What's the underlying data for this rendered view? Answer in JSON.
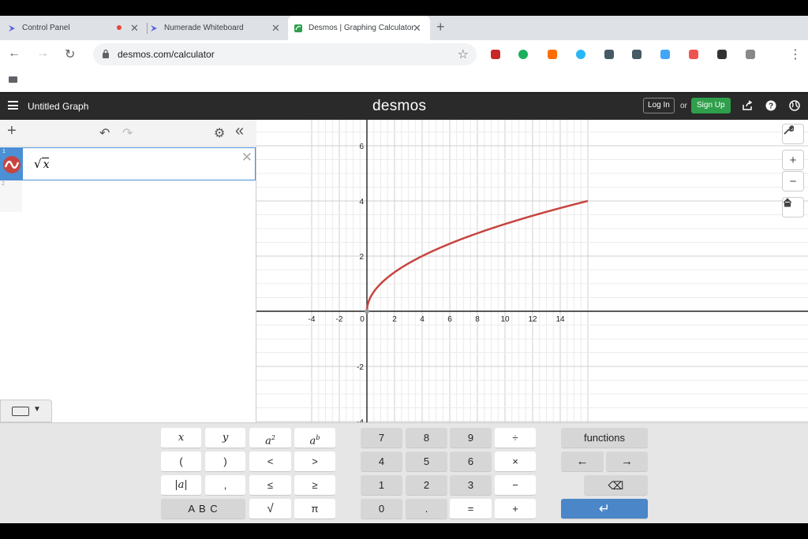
{
  "browser": {
    "tabs": [
      {
        "title": "Control Panel",
        "close": "✕"
      },
      {
        "title": "Numerade Whiteboard",
        "close": "✕"
      },
      {
        "title": "Desmos | Graphing Calculator",
        "close": "✕",
        "active": true
      }
    ],
    "new_tab": "+",
    "back_icon": "←",
    "forward_icon": "→",
    "reload_icon": "↻",
    "url": "desmos.com/calculator",
    "star_icon": "☆",
    "menu_icon": "⋮",
    "extension_colors": [
      "#c62828",
      "#1aaf5d",
      "#ff6d00",
      "#29b6f6",
      "#455a64",
      "#455a64",
      "#42a5f5",
      "#ef5350",
      "#333333",
      "#888888"
    ]
  },
  "desmos": {
    "graph_title": "Untitled Graph",
    "logo": "desmos",
    "login_label": "Log In",
    "or_label": "or",
    "signup_label": "Sign Up",
    "accent_green": "#2f9f4b",
    "expressions": [
      {
        "index": "1",
        "sqrt_symbol": "√",
        "variable": "x",
        "color": "#c74440"
      },
      {
        "index": "2"
      }
    ],
    "delete_icon": "✕",
    "add_icon": "+",
    "undo_icon": "↶",
    "redo_icon": "↷",
    "settings_icon": "⚙",
    "collapse_icon": "«"
  },
  "graph": {
    "x_ticks": [
      "-4",
      "-2",
      "0",
      "2",
      "4",
      "6",
      "8",
      "10",
      "12",
      "14"
    ],
    "y_ticks": [
      "6",
      "4",
      "2",
      "-2",
      "-4"
    ],
    "xlim": [
      -4,
      16
    ],
    "ylim": [
      -4,
      7
    ],
    "curve": "sqrt",
    "curve_color": "#c74440",
    "grid": true,
    "tools": {
      "wrench": "🔧",
      "zoom_in": "+",
      "zoom_out": "−",
      "home": "⌂"
    }
  },
  "keypad": {
    "left": [
      [
        "x",
        "y",
        "a",
        "a"
      ],
      [
        "(",
        ")",
        "<",
        ">"
      ],
      [
        "|a|",
        ",",
        "≤",
        "≥"
      ],
      [
        "A B C",
        "√",
        "π"
      ]
    ],
    "sup_labels": [
      "2",
      "b"
    ],
    "numbers": [
      [
        "7",
        "8",
        "9",
        "÷"
      ],
      [
        "4",
        "5",
        "6",
        "×"
      ],
      [
        "1",
        "2",
        "3",
        "−"
      ],
      [
        "0",
        ".",
        "=",
        "+"
      ]
    ],
    "functions_label": "functions",
    "left_arrow": "←",
    "right_arrow": "→",
    "backspace": "⌫",
    "enter": "↵"
  }
}
